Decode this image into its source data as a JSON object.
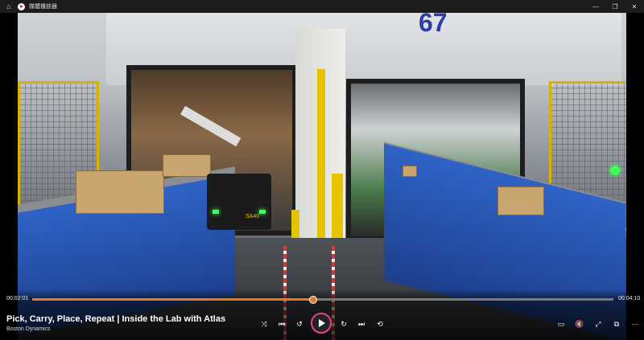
{
  "window": {
    "title": "媒體播放器",
    "home_icon": "home-icon",
    "app_icon": "media-player-icon",
    "minimize": "—",
    "restore": "❐",
    "close": "✕"
  },
  "video": {
    "title": "Pick, Carry, Place, Repeat | Inside the Lab with Atlas",
    "channel": "Boston Dynamics",
    "dock_number": "67",
    "robot_label": "SA40"
  },
  "playback": {
    "current_time": "00:02:01",
    "total_time": "00:04:10",
    "progress": 0.484,
    "accent_color": "#e57a2a",
    "play_ring_color": "#e2458a"
  },
  "controls": {
    "shuffle": "⤨",
    "previous": "⏮",
    "rewind": "↺",
    "forward": "↻",
    "next": "⏭",
    "repeat": "⟲",
    "captions": "▭",
    "volume": "🔇",
    "fullscreen": "⤢",
    "miniplayer": "⧉",
    "more": "⋯"
  }
}
